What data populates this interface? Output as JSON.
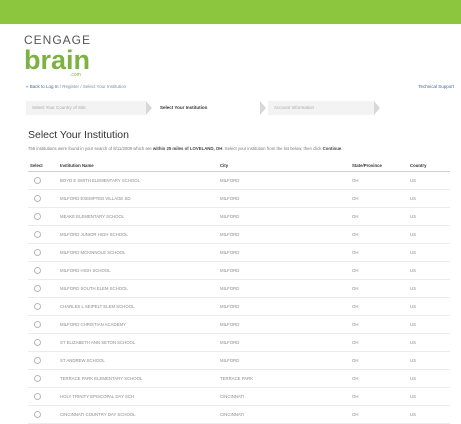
{
  "brand": {
    "logo_top": "CENGAGE",
    "logo_main": "brain",
    "logo_dotcom": ".com"
  },
  "breadcrumb": {
    "back": "« Back to Log In",
    "register": "Register",
    "current": "Select Your Institution",
    "sep": " / "
  },
  "tech_support": "Technical Support",
  "steps": [
    {
      "label": "Select Your Country of Site"
    },
    {
      "label": "Select Your Institution"
    },
    {
      "label": "Account Information"
    }
  ],
  "page_title": "Select Your Institution",
  "intro": {
    "pre": "755 institutions were found in your search of 8/11/2009 which are ",
    "bold1": "within 25 miles of LOVELAND, OH",
    "mid": ". Select your institution from the list below, then click ",
    "bold2": "Continue",
    "post": "."
  },
  "table": {
    "headers": {
      "select": "Select",
      "name": "Institution Name",
      "city": "City",
      "state": "State/Province",
      "country": "Country"
    },
    "rows": [
      {
        "name": "BOYD E SMITH ELEMENTARY SCHOOL",
        "city": "MILFORD",
        "state": "OH",
        "country": "US"
      },
      {
        "name": "MILFORD EXEMPTED VILLAGE SD",
        "city": "MILFORD",
        "state": "OH",
        "country": "US"
      },
      {
        "name": "MEAKE ELEMENTARY SCHOOL",
        "city": "MILFORD",
        "state": "OH",
        "country": "US"
      },
      {
        "name": "MILFORD JUNIOR HIGH SCHOOL",
        "city": "MILFORD",
        "state": "OH",
        "country": "US"
      },
      {
        "name": "MILFORD MCKINNOLE SCHOOL",
        "city": "MILFORD",
        "state": "OH",
        "country": "US"
      },
      {
        "name": "MILFORD HIGH SCHOOL",
        "city": "MILFORD",
        "state": "OH",
        "country": "US"
      },
      {
        "name": "MILFORD SOUTH ELEM SCHOOL",
        "city": "MILFORD",
        "state": "OH",
        "country": "US"
      },
      {
        "name": "CHARLES L SEIPELT ELEM SCHOOL",
        "city": "MILFORD",
        "state": "OH",
        "country": "US"
      },
      {
        "name": "MILFORD CHRISTIAN ACADEMY",
        "city": "MILFORD",
        "state": "OH",
        "country": "US"
      },
      {
        "name": "ST ELIZABETH ANN SETON SCHOOL",
        "city": "MILFORD",
        "state": "OH",
        "country": "US"
      },
      {
        "name": "ST ANDREW SCHOOL",
        "city": "MILFORD",
        "state": "OH",
        "country": "US"
      },
      {
        "name": "TERRACE PARK ELEMENTARY SCHOOL",
        "city": "TERRACE PARK",
        "state": "OH",
        "country": "US"
      },
      {
        "name": "HOLY TRINITY EPISCOPAL DAY SCH",
        "city": "CINCINNATI",
        "state": "OH",
        "country": "US"
      },
      {
        "name": "CINCINNATI COUNTRY DAY SCHOOL",
        "city": "CINCINNATI",
        "state": "OH",
        "country": "US"
      }
    ]
  }
}
